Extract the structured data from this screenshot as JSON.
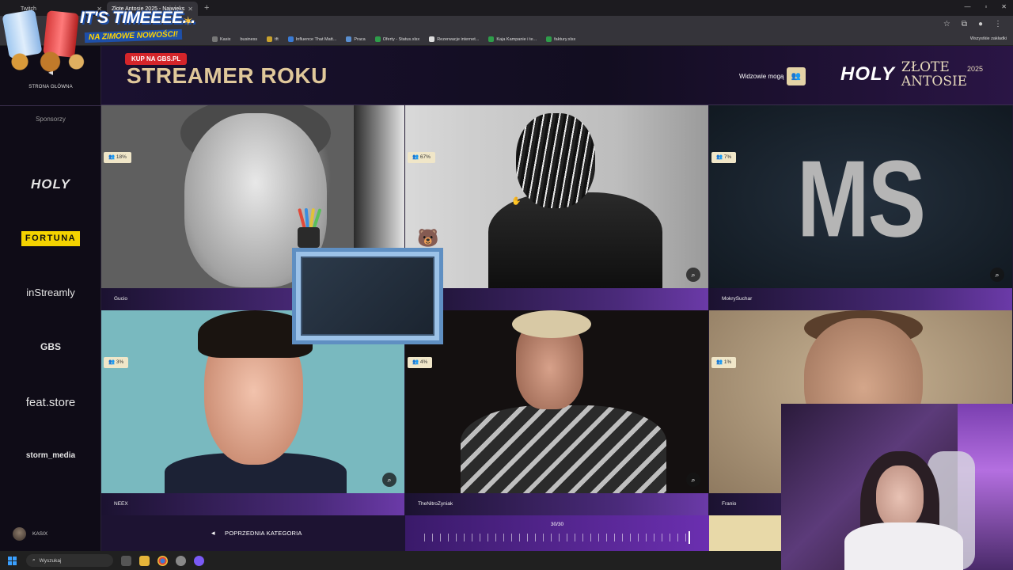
{
  "browser": {
    "tabs": [
      {
        "title": "Twitch",
        "active": false
      },
      {
        "title": "Złote Antosie 2025 - Najwięks",
        "active": true
      }
    ],
    "bookmarks": [
      "Kasix",
      "business",
      "tft",
      "Influence That Matt...",
      "Praca",
      "Oferty - Status.xlsx",
      "Rezerwacje internet...",
      "Kaja Kampanie i te...",
      "faktury.xlsx"
    ],
    "all_bookmarks": "Wszystkie zakładki"
  },
  "ad": {
    "title": "IT'S TIMEEEE...",
    "subtitle": "NA ZIMOWE NOWOŚCI!",
    "cta": "KUP NA GBS.PL"
  },
  "sidebar": {
    "home_label": "STRONA GŁÓWNA",
    "sponsors_label": "Sponsorzy",
    "sponsors": {
      "holy": "HOLY",
      "fortuna": "FORTUNA",
      "instreamly": "inStreamly",
      "gbs": "GBS",
      "feat": "feat.store",
      "storm": "storm_media"
    },
    "user": "KASIX"
  },
  "header": {
    "title": "STREAMER ROKU",
    "viewers_label": "Widzowie mogą",
    "brand_holy": "HOLY",
    "brand_line1": "ZŁOTE",
    "brand_line2": "ANTOSIE",
    "brand_year": "2025"
  },
  "nominees": [
    {
      "name": "Gucio",
      "percent": "18%"
    },
    {
      "name": "",
      "percent": "67%"
    },
    {
      "name": "MokrySuchar",
      "percent": "7%"
    },
    {
      "name": "NEEX",
      "percent": "3%"
    },
    {
      "name": "TheNitroZyniak",
      "percent": "4%"
    },
    {
      "name": "Franio",
      "percent": "1%"
    }
  ],
  "ms_image_text": "MS",
  "footer": {
    "prev_label": "POPRZEDNIA KATEGORIA",
    "progress": "30/30"
  },
  "taskbar": {
    "search_placeholder": "Wyszukaj"
  }
}
